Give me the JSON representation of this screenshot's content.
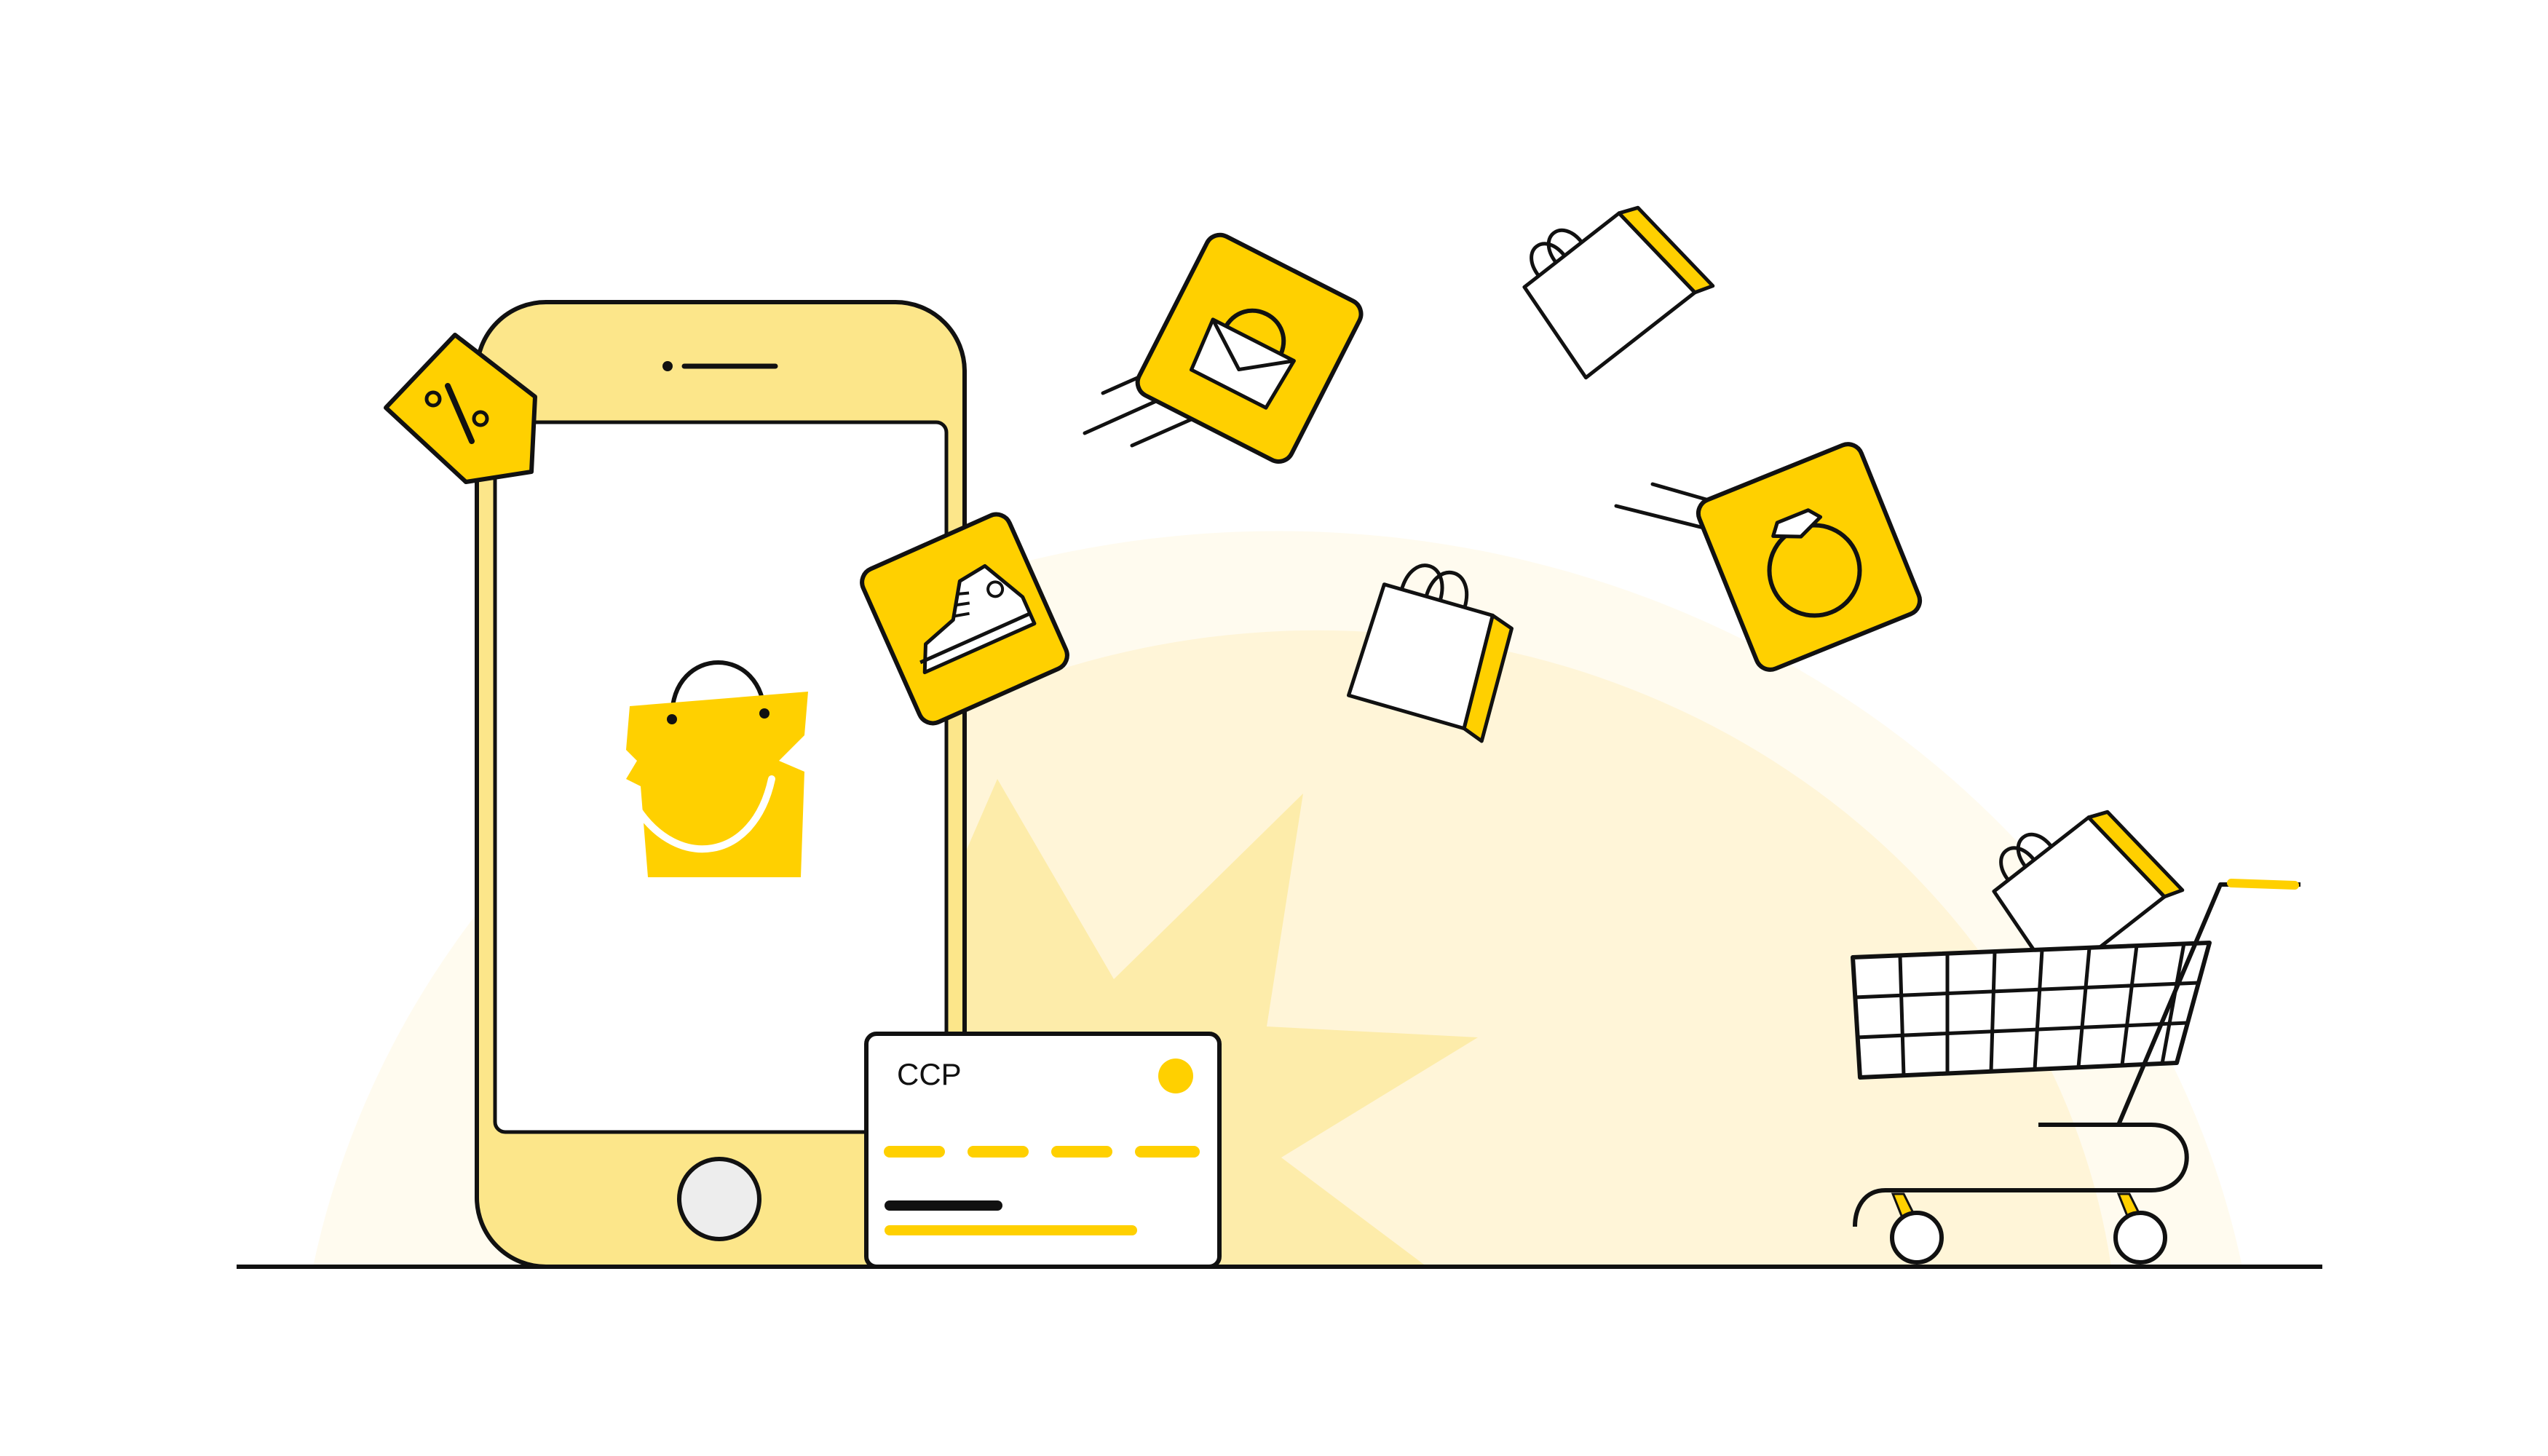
{
  "card": {
    "label": "CCP"
  },
  "colors": {
    "accent": "#FFD000",
    "phone_body": "#FCE68A",
    "halo_outer": "#FFFBEF",
    "halo_inner": "#FFF5D8",
    "burst": "#FDECAA",
    "outline": "#111111",
    "home_button": "#EDEDED"
  },
  "icons": [
    "percent-tag-icon",
    "shopping-bag-icon",
    "sneaker-icon",
    "handbag-icon",
    "ring-icon",
    "shopping-cart-icon",
    "credit-card-icon"
  ]
}
